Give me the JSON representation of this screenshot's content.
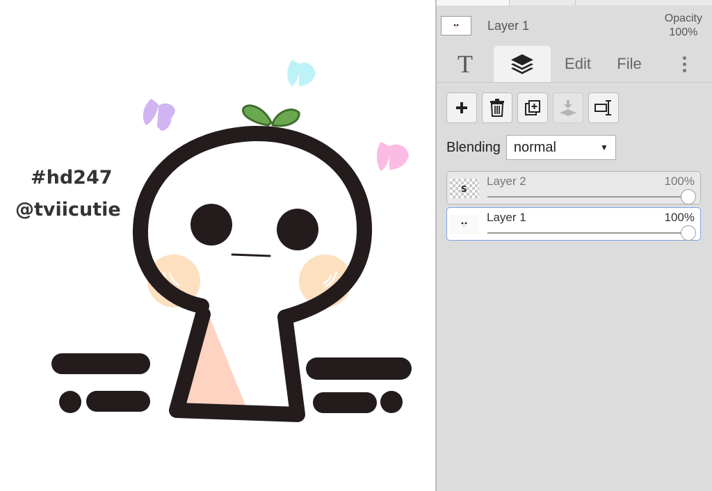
{
  "canvas": {
    "caption_line1": "#hd247",
    "caption_line2": "@tviicutie",
    "colors": {
      "outline": "#241c1c",
      "cheek": "#fde0c0",
      "body_shade": "#ffd3c2",
      "sprout": "#6aa84f",
      "butterfly_purple": "#d1b4f2",
      "butterfly_blue": "#bdf2f8",
      "butterfly_pink": "#fbbbe3"
    }
  },
  "panel": {
    "current_layer": {
      "name": "Layer 1",
      "opacity_label": "Opacity",
      "opacity_value": "100%"
    },
    "tabs": [
      {
        "label": "T",
        "icon": "text-tool-icon"
      },
      {
        "label": "",
        "icon": "layers-icon",
        "active": true
      },
      {
        "label": "Edit"
      },
      {
        "label": "File"
      },
      {
        "label": "",
        "icon": "more-vertical-icon"
      }
    ],
    "tools": [
      {
        "icon": "plus-icon",
        "action": "add-layer"
      },
      {
        "icon": "trash-icon",
        "action": "delete-layer"
      },
      {
        "icon": "duplicate-icon",
        "action": "duplicate-layer"
      },
      {
        "icon": "merge-down-icon",
        "action": "merge-down",
        "disabled": true
      },
      {
        "icon": "rename-icon",
        "action": "rename-layer"
      }
    ],
    "blending": {
      "label": "Blending",
      "value": "normal"
    },
    "layers": [
      {
        "name": "Layer 2",
        "opacity": "100%",
        "opacity_value": 1.0,
        "selected": false
      },
      {
        "name": "Layer 1",
        "opacity": "100%",
        "opacity_value": 1.0,
        "selected": true
      }
    ]
  }
}
